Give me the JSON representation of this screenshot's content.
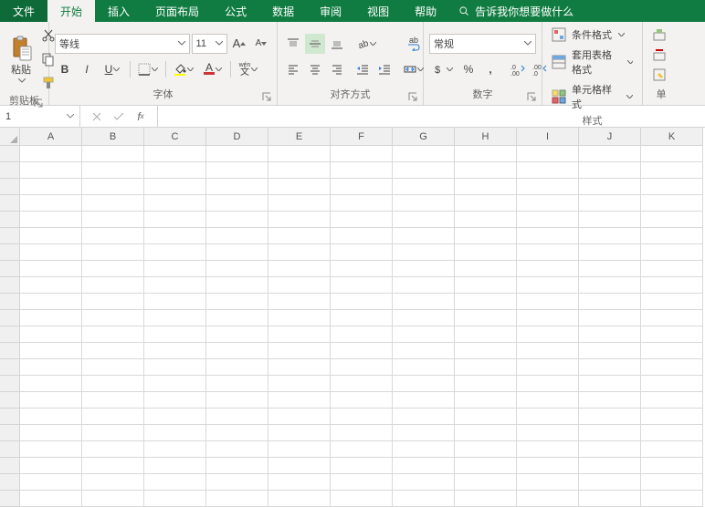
{
  "tabs": {
    "file": "文件",
    "home": "开始",
    "insert": "插入",
    "page_layout": "页面布局",
    "formulas": "公式",
    "data": "数据",
    "review": "审阅",
    "view": "视图",
    "help": "帮助"
  },
  "tell_me": "告诉我你想要做什么",
  "ribbon": {
    "clipboard": {
      "paste": "粘贴",
      "label": "剪贴板"
    },
    "font": {
      "name": "等线",
      "size": "11",
      "label": "字体",
      "wen": "wén",
      "wen2": "文"
    },
    "alignment": {
      "wrap": "ab",
      "label": "对齐方式"
    },
    "number": {
      "format": "常规",
      "label": "数字"
    },
    "styles": {
      "conditional": "条件格式",
      "table": "套用表格格式",
      "cell": "单元格样式",
      "label": "样式"
    },
    "cells_group": {
      "label": "单"
    }
  },
  "name_box": "1",
  "grid": {
    "columns": [
      "A",
      "B",
      "C",
      "D",
      "E",
      "F",
      "G",
      "H",
      "I",
      "J",
      "K"
    ],
    "row_count": 22
  }
}
